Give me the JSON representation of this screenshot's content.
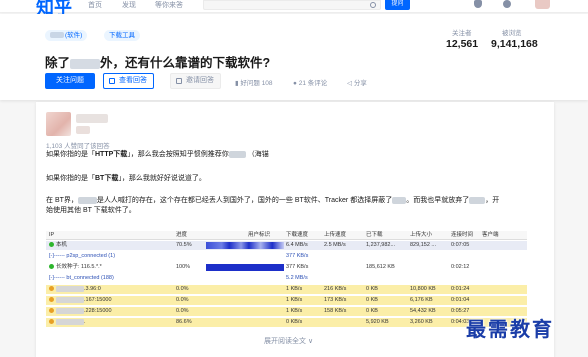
{
  "topbar": {
    "logo": "知乎",
    "nav": [
      "首页",
      "发现",
      "等你来答"
    ],
    "ask_label": "提问"
  },
  "question": {
    "tags": [
      "(软件)",
      "下载工具"
    ],
    "title_prefix": "除了",
    "title_suffix": "外，还有什么靠谱的下载软件?",
    "followers_label": "关注者",
    "followers": "12,561",
    "views_label": "被浏览",
    "views": "9,141,168",
    "follow_btn": "关注问题",
    "answer_btn": "查看回答",
    "invite_btn": "邀请回答",
    "like_count": "好问题 108",
    "comment_count": "21 条评论",
    "share": "分享"
  },
  "answer": {
    "upvote_info": "1,103 人赞同了该回答",
    "p1_a": "如果你指的是「",
    "p1_bold": "HTTP下载",
    "p1_b": "」，那么我会按照知乎惯例推荐你",
    "p1_c": "（海锚",
    "p2_a": "如果你指的是「",
    "p2_bold": "BT下载",
    "p2_b": "」，那么我就好好说说道了。",
    "p3_a": "在 BT界，",
    "p3_b": "是人人喊打的存在，这个存在都已经丢人到国外了，国外的一些 BT软件、Tracker 都选择屏蔽了",
    "p3_c": "。而我也早就放弃了",
    "p3_d": "，开",
    "p3_e": "始使用其他 BT 下载软件了。",
    "expand": "展开阅读全文 ∨",
    "table": {
      "headers": [
        "IP",
        "",
        "进度",
        "用户标识",
        "下载速度",
        "上传速度",
        "已下载",
        "上传大小",
        "连接时间",
        "客户端"
      ],
      "rows": [
        {
          "ip": "本机",
          "progress": "70.5%",
          "down": "6.4 MB/s",
          "up": "2.5 MB/s",
          "downloaded": "1,237,982...",
          "uploaded": "829,152 ...",
          "time": "0:07:05",
          "dot": "#2db52d",
          "bar": 1,
          "highlight": "#e8ebf5"
        },
        {
          "ip": "[-]------ p2sp_connected (1)",
          "progress": "",
          "down": "377 KB/s",
          "up": "",
          "downloaded": "",
          "uploaded": "",
          "time": "",
          "dot": "",
          "bar": 0,
          "highlight": "",
          "link": true
        },
        {
          "ip": "长效种子: 116.5.*.*",
          "progress": "100%",
          "down": "377 KB/s",
          "up": "",
          "downloaded": "185,612 KB",
          "uploaded": "",
          "time": "0:02:12",
          "dot": "#2db52d",
          "bar": 2,
          "highlight": ""
        },
        {
          "ip": "[-]------ bt_connected (188)",
          "progress": "",
          "down": "5.2 MB/s",
          "up": "",
          "downloaded": "",
          "uploaded": "",
          "time": "",
          "dot": "",
          "bar": 0,
          "highlight": "",
          "link": true
        },
        {
          "ip": ".3.96:0",
          "progress": "0.0%",
          "down": "1 KB/s",
          "up": "216 KB/s",
          "downloaded": "0 KB",
          "uploaded": "10,800 KB",
          "time": "0:01:24",
          "dot": "#e8a024",
          "bar": 0,
          "highlight": "#fbeea8"
        },
        {
          "ip": ".167:15000",
          "progress": "0.0%",
          "down": "1 KB/s",
          "up": "173 KB/s",
          "downloaded": "0 KB",
          "uploaded": "6,176 KB",
          "time": "0:01:04",
          "dot": "#e8a024",
          "bar": 0,
          "highlight": "#fbeea8"
        },
        {
          "ip": ".228:15000",
          "progress": "0.0%",
          "down": "1 KB/s",
          "up": "158 KB/s",
          "downloaded": "0 KB",
          "uploaded": "54,432 KB",
          "time": "0:05:27",
          "dot": "#e8a024",
          "bar": 0,
          "highlight": "#fbeea8"
        },
        {
          "ip": ".",
          "progress": "86.6%",
          "down": "0 KB/s",
          "up": "",
          "downloaded": "5,920 KB",
          "uploaded": "3,260 KB",
          "time": "0:04:03",
          "dot": "#e8a024",
          "bar": 0,
          "highlight": "#fbeea8"
        }
      ]
    }
  },
  "watermark": "最需教育",
  "colors": {
    "accent": "#0066ff",
    "muted": "#8590a6"
  }
}
